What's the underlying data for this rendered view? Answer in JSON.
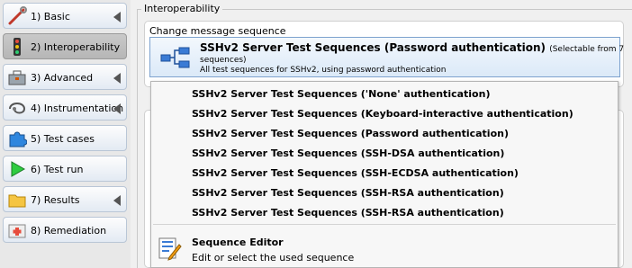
{
  "sidebar": {
    "items": [
      {
        "label": "1) Basic",
        "icon": "wrench-icon",
        "arrow": true,
        "active": false
      },
      {
        "label": "2) Interoperability",
        "icon": "traffic-light-icon",
        "arrow": false,
        "active": true
      },
      {
        "label": "3) Advanced",
        "icon": "toolbox-icon",
        "arrow": true,
        "active": false
      },
      {
        "label": "4) Instrumentation",
        "icon": "stethoscope-icon",
        "arrow": true,
        "active": false
      },
      {
        "label": "5) Test cases",
        "icon": "puzzle-icon",
        "arrow": false,
        "active": false
      },
      {
        "label": "6) Test run",
        "icon": "play-icon",
        "arrow": false,
        "active": false
      },
      {
        "label": "7) Results",
        "icon": "folder-icon",
        "arrow": true,
        "active": false
      },
      {
        "label": "8) Remediation",
        "icon": "first-aid-icon",
        "arrow": false,
        "active": false
      }
    ]
  },
  "main": {
    "group_title": "Interoperability",
    "panel_title": "Change message sequence",
    "selector": {
      "title": "SSHv2 Server Test Sequences (Password authentication)",
      "note": "(Selectable from 7",
      "note2": "sequences)",
      "description": "All test sequences for SSHv2, using password authentication"
    }
  },
  "dropdown": {
    "items": [
      "SSHv2 Server Test Sequences ('None' authentication)",
      "SSHv2 Server Test Sequences (Keyboard-interactive authentication)",
      "SSHv2 Server Test Sequences (Password authentication)",
      "SSHv2 Server Test Sequences (SSH-DSA authentication)",
      "SSHv2 Server Test Sequences (SSH-ECDSA authentication)",
      "SSHv2 Server Test Sequences (SSH-RSA authentication)",
      "SSHv2 Server Test Sequences (SSH-RSA authentication)"
    ],
    "editor_title": "Sequence Editor",
    "editor_desc": "Edit or select the used sequence"
  }
}
